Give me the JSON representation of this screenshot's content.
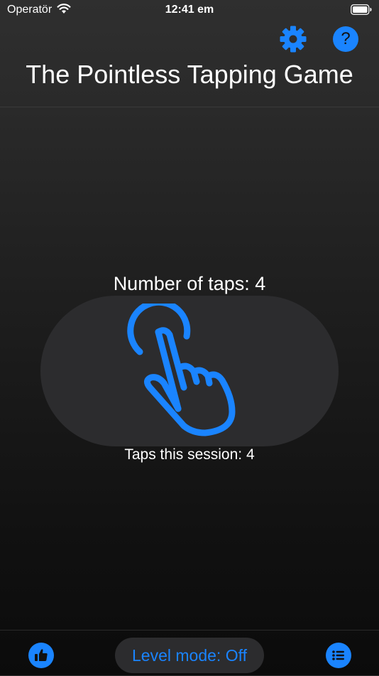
{
  "status_bar": {
    "carrier": "Operatör",
    "time": "12:41 em",
    "wifi_icon": "wifi-icon",
    "battery_icon": "battery-icon"
  },
  "header": {
    "title": "The Pointless Tapping Game",
    "settings_icon": "gear-icon",
    "help_label": "?"
  },
  "game": {
    "taps_label": "Number of taps: 4",
    "session_label": "Taps this session: 4",
    "tap_icon": "tap-hand-icon"
  },
  "bottom_bar": {
    "like_icon": "thumbs-up-icon",
    "level_mode_label": "Level mode: Off",
    "list_icon": "list-icon"
  },
  "colors": {
    "accent": "#1a84ff",
    "pill_background": "#2c2c2e"
  }
}
